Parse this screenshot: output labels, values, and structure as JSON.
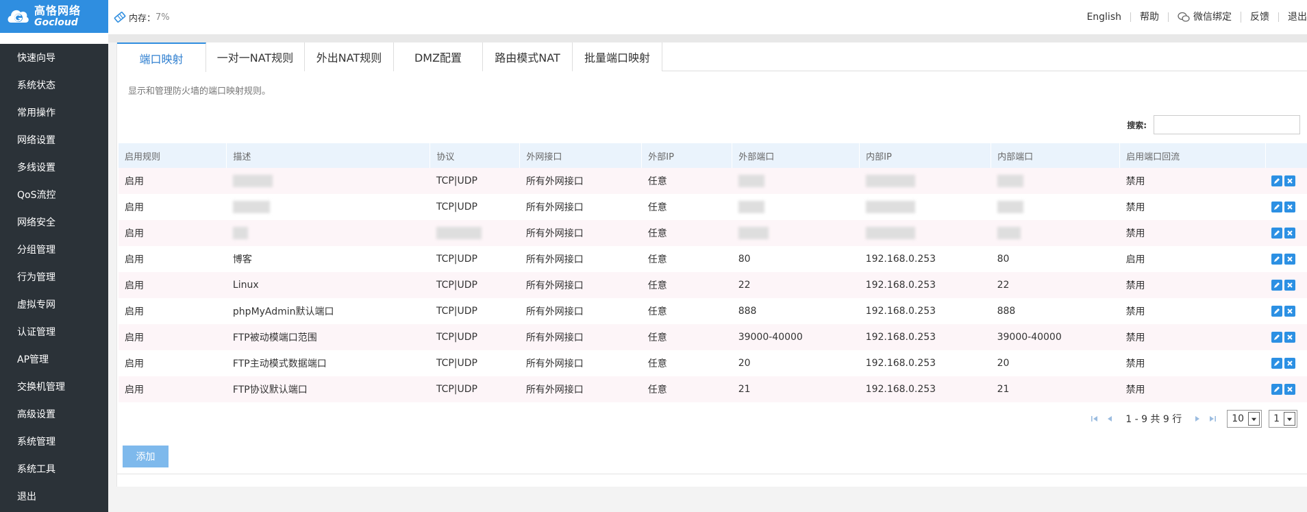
{
  "logo": {
    "cn": "高恪网络",
    "en": "Gocloud"
  },
  "memory": {
    "label": "内存：",
    "value": "7%"
  },
  "top_links": {
    "english": "English",
    "help": "帮助",
    "wechat": "微信绑定",
    "feedback": "反馈",
    "logout": "退出"
  },
  "sidebar": {
    "items": [
      {
        "label": "快速向导"
      },
      {
        "label": "系统状态"
      },
      {
        "label": "常用操作"
      },
      {
        "label": "网络设置"
      },
      {
        "label": "多线设置"
      },
      {
        "label": "QoS流控"
      },
      {
        "label": "网络安全"
      },
      {
        "label": "分组管理"
      },
      {
        "label": "行为管理"
      },
      {
        "label": "虚拟专网"
      },
      {
        "label": "认证管理"
      },
      {
        "label": "AP管理"
      },
      {
        "label": "交换机管理"
      },
      {
        "label": "高级设置"
      },
      {
        "label": "系统管理"
      },
      {
        "label": "系统工具"
      },
      {
        "label": "退出"
      }
    ]
  },
  "tabs": [
    {
      "label": "端口映射",
      "active": true
    },
    {
      "label": "一对一NAT规则"
    },
    {
      "label": "外出NAT规则"
    },
    {
      "label": "DMZ配置"
    },
    {
      "label": "路由模式NAT"
    },
    {
      "label": "批量端口映射"
    }
  ],
  "description": "显示和管理防火墙的端口映射规则。",
  "search": {
    "label": "搜索:",
    "value": ""
  },
  "table": {
    "headers": [
      "启用规则",
      "描述",
      "协议",
      "外网接口",
      "外部IP",
      "外部端口",
      "内部IP",
      "内部端口",
      "启用端口回流",
      ""
    ],
    "rows": [
      {
        "enable": "启用",
        "desc": "",
        "proto": "TCP|UDP",
        "wan": "所有外网接口",
        "ext_ip": "任意",
        "ext_port": "",
        "int_ip": "",
        "int_port": "",
        "loopback": "禁用"
      },
      {
        "enable": "启用",
        "desc": "",
        "proto": "TCP|UDP",
        "wan": "所有外网接口",
        "ext_ip": "任意",
        "ext_port": "",
        "int_ip": "",
        "int_port": "",
        "loopback": "禁用"
      },
      {
        "enable": "启用",
        "desc": "",
        "proto": "",
        "wan": "所有外网接口",
        "ext_ip": "任意",
        "ext_port": "",
        "int_ip": "",
        "int_port": "",
        "loopback": "禁用"
      },
      {
        "enable": "启用",
        "desc": "博客",
        "proto": "TCP|UDP",
        "wan": "所有外网接口",
        "ext_ip": "任意",
        "ext_port": "80",
        "int_ip": "192.168.0.253",
        "int_port": "80",
        "loopback": "启用"
      },
      {
        "enable": "启用",
        "desc": "Linux",
        "proto": "TCP|UDP",
        "wan": "所有外网接口",
        "ext_ip": "任意",
        "ext_port": "22",
        "int_ip": "192.168.0.253",
        "int_port": "22",
        "loopback": "禁用"
      },
      {
        "enable": "启用",
        "desc": "phpMyAdmin默认端口",
        "proto": "TCP|UDP",
        "wan": "所有外网接口",
        "ext_ip": "任意",
        "ext_port": "888",
        "int_ip": "192.168.0.253",
        "int_port": "888",
        "loopback": "禁用"
      },
      {
        "enable": "启用",
        "desc": "FTP被动模端口范围",
        "proto": "TCP|UDP",
        "wan": "所有外网接口",
        "ext_ip": "任意",
        "ext_port": "39000-40000",
        "int_ip": "192.168.0.253",
        "int_port": "39000-40000",
        "loopback": "禁用"
      },
      {
        "enable": "启用",
        "desc": "FTP主动模式数据端口",
        "proto": "TCP|UDP",
        "wan": "所有外网接口",
        "ext_ip": "任意",
        "ext_port": "20",
        "int_ip": "192.168.0.253",
        "int_port": "20",
        "loopback": "禁用"
      },
      {
        "enable": "启用",
        "desc": "FTP协议默认端口",
        "proto": "TCP|UDP",
        "wan": "所有外网接口",
        "ext_ip": "任意",
        "ext_port": "21",
        "int_ip": "192.168.0.253",
        "int_port": "21",
        "loopback": "禁用"
      }
    ]
  },
  "pager": {
    "info": "1 - 9 共 9 行",
    "page_size": "10",
    "page": "1"
  },
  "add_button": "添加",
  "colors": {
    "accent": "#2f8ee0",
    "sidebar_bg": "#2b3238",
    "header_row": "#eaf3fc",
    "odd_row": "#fdf5f8",
    "add_btn": "#7eb9ec"
  }
}
